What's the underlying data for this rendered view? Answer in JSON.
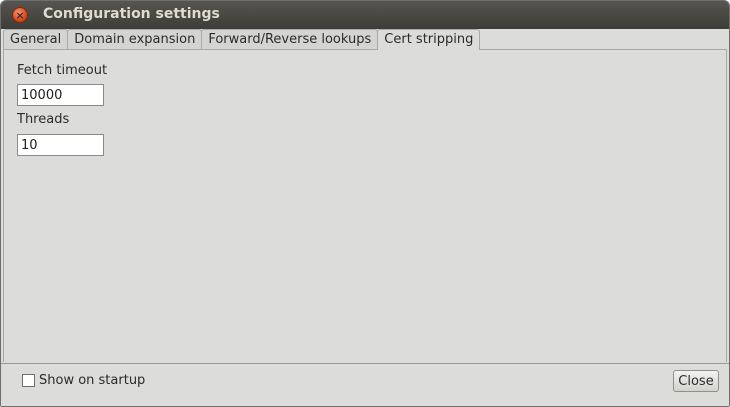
{
  "window": {
    "title": "Configuration settings"
  },
  "tabs": [
    {
      "label": "General",
      "active": false
    },
    {
      "label": "Domain expansion",
      "active": false
    },
    {
      "label": "Forward/Reverse lookups",
      "active": false
    },
    {
      "label": "Cert stripping",
      "active": true
    }
  ],
  "fields": {
    "fetch_timeout": {
      "label": "Fetch timeout",
      "value": "10000"
    },
    "threads": {
      "label": "Threads",
      "value": "10"
    }
  },
  "footer": {
    "show_on_startup_label": "Show on startup",
    "show_on_startup_checked": false,
    "close_label": "Close"
  },
  "icons": {
    "window_close": "close-icon"
  },
  "colors": {
    "titlebar": "#3d3c37",
    "close_button_accent": "#d9471c",
    "panel_background": "#dcdddb"
  }
}
